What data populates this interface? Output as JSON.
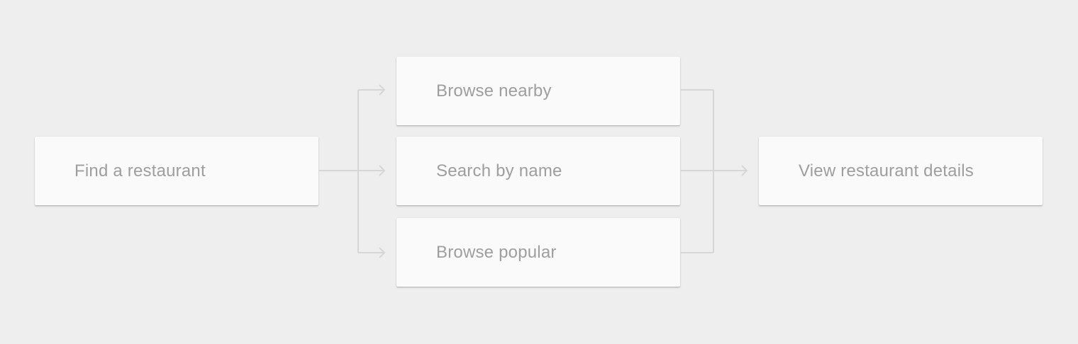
{
  "diagram": {
    "colors": {
      "background": "#eeeeee",
      "card_fill": "#fafafa",
      "label_text": "#9e9e9e",
      "connector": "#d6d6d6"
    },
    "nodes": {
      "start": {
        "label": "Find a restaurant"
      },
      "nearby": {
        "label": "Browse nearby"
      },
      "search": {
        "label": "Search by name"
      },
      "popular": {
        "label": "Browse popular"
      },
      "details": {
        "label": "View restaurant details"
      }
    },
    "edges": [
      {
        "from": "start",
        "to": "nearby"
      },
      {
        "from": "start",
        "to": "search"
      },
      {
        "from": "start",
        "to": "popular"
      },
      {
        "from": "nearby",
        "to": "details"
      },
      {
        "from": "search",
        "to": "details"
      },
      {
        "from": "popular",
        "to": "details"
      }
    ]
  }
}
